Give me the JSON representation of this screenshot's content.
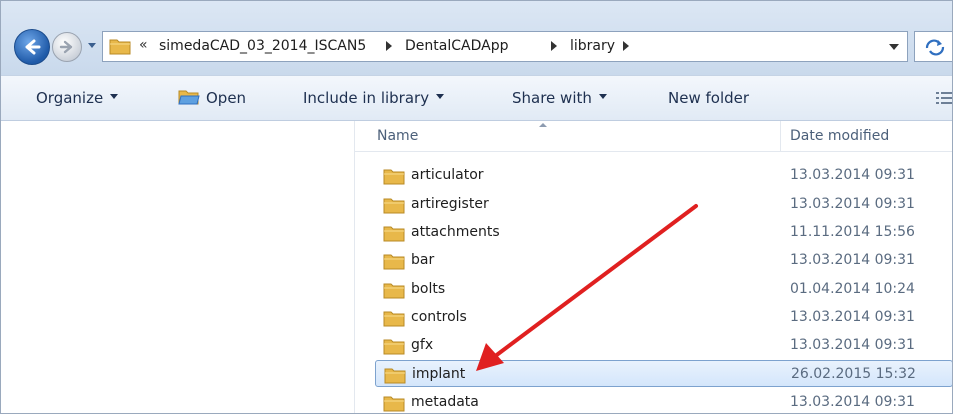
{
  "navigation": {
    "breadcrumb": [
      "simedaCAD_03_2014_ISCAN5",
      "DentalCADApp",
      "library"
    ],
    "overflow_marker": "«"
  },
  "toolbar": {
    "organize": "Organize",
    "open": "Open",
    "include_in_library": "Include in library",
    "share_with": "Share with",
    "new_folder": "New folder"
  },
  "columns": {
    "name": "Name",
    "date_modified": "Date modified"
  },
  "files": [
    {
      "name": "articulator",
      "date": "13.03.2014 09:31",
      "selected": false
    },
    {
      "name": "artiregister",
      "date": "13.03.2014 09:31",
      "selected": false
    },
    {
      "name": "attachments",
      "date": "11.11.2014 15:56",
      "selected": false
    },
    {
      "name": "bar",
      "date": "13.03.2014 09:31",
      "selected": false
    },
    {
      "name": "bolts",
      "date": "01.04.2014 10:24",
      "selected": false
    },
    {
      "name": "controls",
      "date": "13.03.2014 09:31",
      "selected": false
    },
    {
      "name": "gfx",
      "date": "13.03.2014 09:31",
      "selected": false
    },
    {
      "name": "implant",
      "date": "26.02.2015 15:32",
      "selected": true
    },
    {
      "name": "metadata",
      "date": "13.03.2014 09:31",
      "selected": false
    }
  ],
  "colors": {
    "annotation_arrow": "#e02020",
    "selection": "#cce2fb",
    "folder": "#e8b84a"
  },
  "icons": {
    "back": "back-arrow-icon",
    "forward": "forward-arrow-icon",
    "folder": "folder-icon",
    "refresh": "refresh-icon",
    "open": "open-folder-icon",
    "views": "views-icon"
  }
}
